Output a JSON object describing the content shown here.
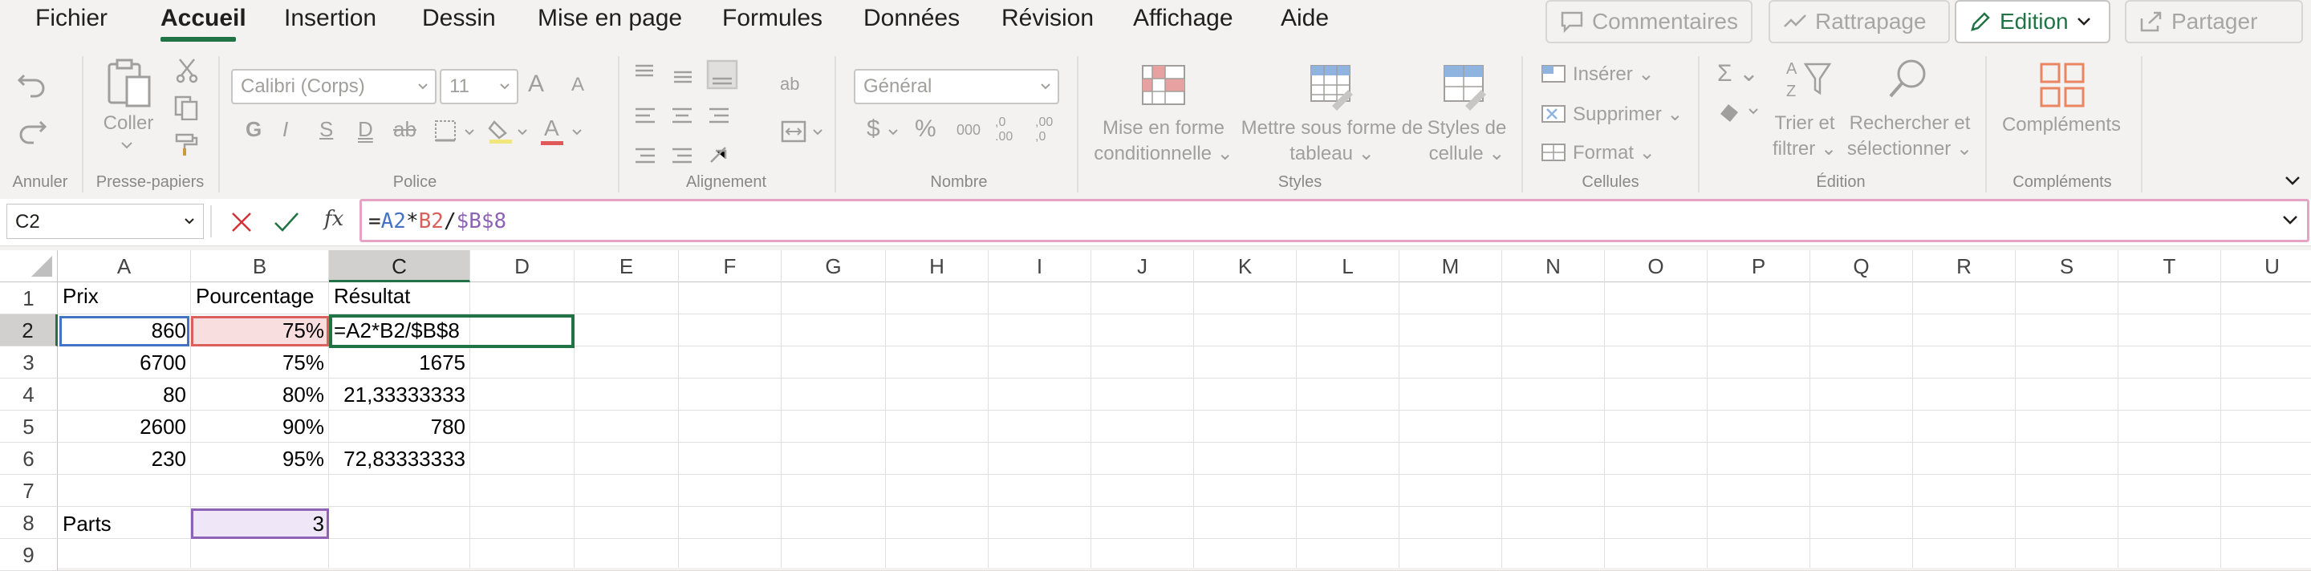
{
  "tabs": [
    "Fichier",
    "Accueil",
    "Insertion",
    "Dessin",
    "Mise en page",
    "Formules",
    "Données",
    "Révision",
    "Affichage",
    "Aide"
  ],
  "top_buttons": {
    "comments": "Commentaires",
    "track": "Rattrapage",
    "edit": "Edition",
    "share": "Partager"
  },
  "ribbon": {
    "groups": {
      "undo": "Annuler",
      "clipboard": "Presse-papiers",
      "font": "Police",
      "alignment": "Alignement",
      "number": "Nombre",
      "styles": "Styles",
      "cells": "Cellules",
      "editing": "Édition",
      "addins": "Compléments"
    },
    "paste": "Coller",
    "font_name": "Calibri (Corps)",
    "font_size": "11",
    "number_format": "Général",
    "conditional_1": "Mise en forme",
    "conditional_2": "conditionnelle",
    "table_1": "Mettre sous forme de",
    "table_2": "tableau",
    "cellstyles_1": "Styles de",
    "cellstyles_2": "cellule",
    "insert": "Insérer",
    "delete": "Supprimer",
    "format": "Format",
    "sort_1": "Trier et",
    "sort_2": "filtrer",
    "find_1": "Rechercher et",
    "find_2": "sélectionner",
    "addins": "Compléments",
    "bold": "G",
    "italic": "I",
    "underline": "S",
    "double_underline": "D",
    "currency": "$",
    "percent": "%",
    "thousands": "000",
    "inc_dec": ",0\n.00",
    "dec_dec": ",00\n,0",
    "font_grow": "A",
    "font_shrink": "A",
    "font_color": "A",
    "wrap": "ab"
  },
  "formula_bar": {
    "name_box": "C2",
    "fx": "fx",
    "formula_parts": [
      {
        "text": "=",
        "color": "#201f1e"
      },
      {
        "text": "A2",
        "color": "#4472c4"
      },
      {
        "text": "*",
        "color": "#201f1e"
      },
      {
        "text": "B2",
        "color": "#d9605b"
      },
      {
        "text": "/",
        "color": "#201f1e"
      },
      {
        "text": "$B$8",
        "color": "#8e63b5"
      }
    ]
  },
  "grid": {
    "columns": [
      "A",
      "B",
      "C",
      "D",
      "E",
      "F",
      "G",
      "H",
      "I",
      "J",
      "K",
      "L",
      "M",
      "N",
      "O",
      "P",
      "Q",
      "R",
      "S",
      "T",
      "U"
    ],
    "rows": [
      "1",
      "2",
      "3",
      "4",
      "5",
      "6",
      "7",
      "8",
      "9"
    ],
    "headers": {
      "a": "Prix",
      "b": "Pourcentage",
      "c": "Résultat"
    },
    "data": [
      {
        "a": "860",
        "b": "75%",
        "c": "=A2*B2/$B$8"
      },
      {
        "a": "6700",
        "b": "75%",
        "c": "1675"
      },
      {
        "a": "80",
        "b": "80%",
        "c": "21,33333333"
      },
      {
        "a": "2600",
        "b": "90%",
        "c": "780"
      },
      {
        "a": "230",
        "b": "95%",
        "c": "72,83333333"
      }
    ],
    "parts_label": "Parts",
    "parts_value": "3"
  },
  "colors": {
    "accent": "#217346",
    "ref_a": "#4472c4",
    "ref_b": "#d9605b",
    "ref_b8": "#8e63b5",
    "formula_border": "#e6a4c4"
  }
}
